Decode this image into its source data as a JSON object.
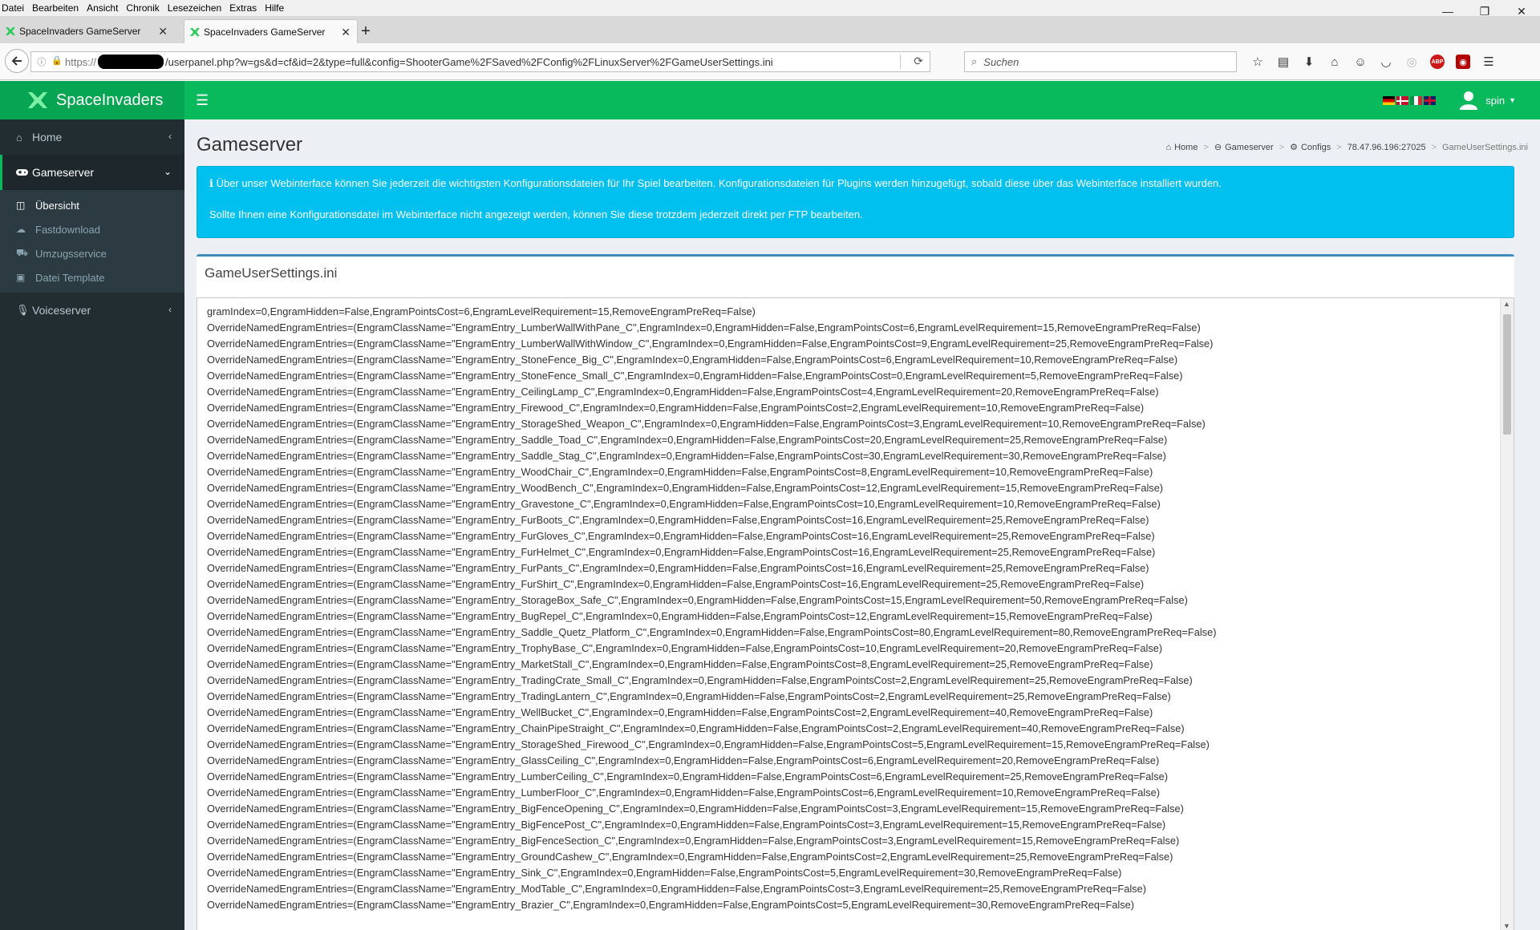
{
  "menubar": {
    "items": [
      "Datei",
      "Bearbeiten",
      "Ansicht",
      "Chronik",
      "Lesezeichen",
      "Extras",
      "Hilfe"
    ]
  },
  "window_controls": {
    "minimize": "—",
    "maximize": "❐",
    "close": "✕"
  },
  "tabs": [
    {
      "label": "SpaceInvaders GameServer"
    },
    {
      "label": "SpaceInvaders GameServer"
    }
  ],
  "tab_close": "✕",
  "newtab": "+",
  "navbar": {
    "url_proto": "https://",
    "url_rest": "/userpanel.php?w=gs&d=cf&id=2&type=full&config=ShooterGame%2FSaved%2FConfig%2FLinuxServer%2FGameUserSettings.ini",
    "search_placeholder": "Suchen"
  },
  "header": {
    "brand": "SpaceInvaders",
    "username": "spin",
    "accent": "#09ba5c",
    "accent_dark": "#06a553"
  },
  "sidebar": {
    "items": [
      {
        "label": "Home",
        "icon": "home-icon"
      },
      {
        "label": "Gameserver",
        "icon": "gamepad-icon"
      },
      {
        "label": "Voiceserver",
        "icon": "microphone-icon"
      }
    ],
    "sub_items": [
      {
        "label": "Übersicht",
        "icon": "columns-icon"
      },
      {
        "label": "Fastdownload",
        "icon": "cloud-download-icon"
      },
      {
        "label": "Umzugsservice",
        "icon": "truck-icon"
      },
      {
        "label": "Datei Template",
        "icon": "save-icon"
      }
    ]
  },
  "content": {
    "page_title": "Gameserver",
    "breadcrumb": [
      "Home",
      "Gameserver",
      "Configs",
      "78.47.96.196:27025",
      "GameUserSettings.ini"
    ],
    "alert_line1": "Über unser Webinterface können Sie jederzeit die wichtigsten Konfigurationsdateien für Ihr Spiel bearbeiten. Konfigurationsdateien für Plugins werden hinzugefügt, sobald diese über das Webinterface installiert wurden.",
    "alert_line2": "Sollte Ihnen eine Konfigurationsdatei im Webinterface nicht angezeigt werden, können Sie diese trotzdem jederzeit direkt per FTP bearbeiten.",
    "box_title": "GameUserSettings.ini"
  },
  "editor": {
    "lines": [
      "gramIndex=0,EngramHidden=False,EngramPointsCost=6,EngramLevelRequirement=15,RemoveEngramPreReq=False)",
      "OverrideNamedEngramEntries=(EngramClassName=\"EngramEntry_LumberWallWithPane_C\",EngramIndex=0,EngramHidden=False,EngramPointsCost=6,EngramLevelRequirement=15,RemoveEngramPreReq=False)",
      "OverrideNamedEngramEntries=(EngramClassName=\"EngramEntry_LumberWallWithWindow_C\",EngramIndex=0,EngramHidden=False,EngramPointsCost=9,EngramLevelRequirement=25,RemoveEngramPreReq=False)",
      "OverrideNamedEngramEntries=(EngramClassName=\"EngramEntry_StoneFence_Big_C\",EngramIndex=0,EngramHidden=False,EngramPointsCost=6,EngramLevelRequirement=10,RemoveEngramPreReq=False)",
      "OverrideNamedEngramEntries=(EngramClassName=\"EngramEntry_StoneFence_Small_C\",EngramIndex=0,EngramHidden=False,EngramPointsCost=0,EngramLevelRequirement=5,RemoveEngramPreReq=False)",
      "OverrideNamedEngramEntries=(EngramClassName=\"EngramEntry_CeilingLamp_C\",EngramIndex=0,EngramHidden=False,EngramPointsCost=4,EngramLevelRequirement=20,RemoveEngramPreReq=False)",
      "OverrideNamedEngramEntries=(EngramClassName=\"EngramEntry_Firewood_C\",EngramIndex=0,EngramHidden=False,EngramPointsCost=2,EngramLevelRequirement=10,RemoveEngramPreReq=False)",
      "OverrideNamedEngramEntries=(EngramClassName=\"EngramEntry_StorageShed_Weapon_C\",EngramIndex=0,EngramHidden=False,EngramPointsCost=3,EngramLevelRequirement=10,RemoveEngramPreReq=False)",
      "OverrideNamedEngramEntries=(EngramClassName=\"EngramEntry_Saddle_Toad_C\",EngramIndex=0,EngramHidden=False,EngramPointsCost=20,EngramLevelRequirement=25,RemoveEngramPreReq=False)",
      "OverrideNamedEngramEntries=(EngramClassName=\"EngramEntry_Saddle_Stag_C\",EngramIndex=0,EngramHidden=False,EngramPointsCost=30,EngramLevelRequirement=30,RemoveEngramPreReq=False)",
      "OverrideNamedEngramEntries=(EngramClassName=\"EngramEntry_WoodChair_C\",EngramIndex=0,EngramHidden=False,EngramPointsCost=8,EngramLevelRequirement=10,RemoveEngramPreReq=False)",
      "OverrideNamedEngramEntries=(EngramClassName=\"EngramEntry_WoodBench_C\",EngramIndex=0,EngramHidden=False,EngramPointsCost=12,EngramLevelRequirement=15,RemoveEngramPreReq=False)",
      "OverrideNamedEngramEntries=(EngramClassName=\"EngramEntry_Gravestone_C\",EngramIndex=0,EngramHidden=False,EngramPointsCost=10,EngramLevelRequirement=10,RemoveEngramPreReq=False)",
      "OverrideNamedEngramEntries=(EngramClassName=\"EngramEntry_FurBoots_C\",EngramIndex=0,EngramHidden=False,EngramPointsCost=16,EngramLevelRequirement=25,RemoveEngramPreReq=False)",
      "OverrideNamedEngramEntries=(EngramClassName=\"EngramEntry_FurGloves_C\",EngramIndex=0,EngramHidden=False,EngramPointsCost=16,EngramLevelRequirement=25,RemoveEngramPreReq=False)",
      "OverrideNamedEngramEntries=(EngramClassName=\"EngramEntry_FurHelmet_C\",EngramIndex=0,EngramHidden=False,EngramPointsCost=16,EngramLevelRequirement=25,RemoveEngramPreReq=False)",
      "OverrideNamedEngramEntries=(EngramClassName=\"EngramEntry_FurPants_C\",EngramIndex=0,EngramHidden=False,EngramPointsCost=16,EngramLevelRequirement=25,RemoveEngramPreReq=False)",
      "OverrideNamedEngramEntries=(EngramClassName=\"EngramEntry_FurShirt_C\",EngramIndex=0,EngramHidden=False,EngramPointsCost=16,EngramLevelRequirement=25,RemoveEngramPreReq=False)",
      "OverrideNamedEngramEntries=(EngramClassName=\"EngramEntry_StorageBox_Safe_C\",EngramIndex=0,EngramHidden=False,EngramPointsCost=15,EngramLevelRequirement=50,RemoveEngramPreReq=False)",
      "OverrideNamedEngramEntries=(EngramClassName=\"EngramEntry_BugRepel_C\",EngramIndex=0,EngramHidden=False,EngramPointsCost=12,EngramLevelRequirement=15,RemoveEngramPreReq=False)",
      "OverrideNamedEngramEntries=(EngramClassName=\"EngramEntry_Saddle_Quetz_Platform_C\",EngramIndex=0,EngramHidden=False,EngramPointsCost=80,EngramLevelRequirement=80,RemoveEngramPreReq=False)",
      "OverrideNamedEngramEntries=(EngramClassName=\"EngramEntry_TrophyBase_C\",EngramIndex=0,EngramHidden=False,EngramPointsCost=10,EngramLevelRequirement=20,RemoveEngramPreReq=False)",
      "OverrideNamedEngramEntries=(EngramClassName=\"EngramEntry_MarketStall_C\",EngramIndex=0,EngramHidden=False,EngramPointsCost=8,EngramLevelRequirement=25,RemoveEngramPreReq=False)",
      "OverrideNamedEngramEntries=(EngramClassName=\"EngramEntry_TradingCrate_Small_C\",EngramIndex=0,EngramHidden=False,EngramPointsCost=2,EngramLevelRequirement=25,RemoveEngramPreReq=False)",
      "OverrideNamedEngramEntries=(EngramClassName=\"EngramEntry_TradingLantern_C\",EngramIndex=0,EngramHidden=False,EngramPointsCost=2,EngramLevelRequirement=25,RemoveEngramPreReq=False)",
      "OverrideNamedEngramEntries=(EngramClassName=\"EngramEntry_WellBucket_C\",EngramIndex=0,EngramHidden=False,EngramPointsCost=2,EngramLevelRequirement=40,RemoveEngramPreReq=False)",
      "OverrideNamedEngramEntries=(EngramClassName=\"EngramEntry_ChainPipeStraight_C\",EngramIndex=0,EngramHidden=False,EngramPointsCost=2,EngramLevelRequirement=40,RemoveEngramPreReq=False)",
      "OverrideNamedEngramEntries=(EngramClassName=\"EngramEntry_StorageShed_Firewood_C\",EngramIndex=0,EngramHidden=False,EngramPointsCost=5,EngramLevelRequirement=15,RemoveEngramPreReq=False)",
      "OverrideNamedEngramEntries=(EngramClassName=\"EngramEntry_GlassCeiling_C\",EngramIndex=0,EngramHidden=False,EngramPointsCost=6,EngramLevelRequirement=20,RemoveEngramPreReq=False)",
      "OverrideNamedEngramEntries=(EngramClassName=\"EngramEntry_LumberCeiling_C\",EngramIndex=0,EngramHidden=False,EngramPointsCost=6,EngramLevelRequirement=25,RemoveEngramPreReq=False)",
      "OverrideNamedEngramEntries=(EngramClassName=\"EngramEntry_LumberFloor_C\",EngramIndex=0,EngramHidden=False,EngramPointsCost=6,EngramLevelRequirement=10,RemoveEngramPreReq=False)",
      "OverrideNamedEngramEntries=(EngramClassName=\"EngramEntry_BigFenceOpening_C\",EngramIndex=0,EngramHidden=False,EngramPointsCost=3,EngramLevelRequirement=15,RemoveEngramPreReq=False)",
      "OverrideNamedEngramEntries=(EngramClassName=\"EngramEntry_BigFencePost_C\",EngramIndex=0,EngramHidden=False,EngramPointsCost=3,EngramLevelRequirement=15,RemoveEngramPreReq=False)",
      "OverrideNamedEngramEntries=(EngramClassName=\"EngramEntry_BigFenceSection_C\",EngramIndex=0,EngramHidden=False,EngramPointsCost=3,EngramLevelRequirement=15,RemoveEngramPreReq=False)",
      "OverrideNamedEngramEntries=(EngramClassName=\"EngramEntry_GroundCashew_C\",EngramIndex=0,EngramHidden=False,EngramPointsCost=2,EngramLevelRequirement=25,RemoveEngramPreReq=False)",
      "OverrideNamedEngramEntries=(EngramClassName=\"EngramEntry_Sink_C\",EngramIndex=0,EngramHidden=False,EngramPointsCost=5,EngramLevelRequirement=30,RemoveEngramPreReq=False)",
      "OverrideNamedEngramEntries=(EngramClassName=\"EngramEntry_ModTable_C\",EngramIndex=0,EngramHidden=False,EngramPointsCost=3,EngramLevelRequirement=25,RemoveEngramPreReq=False)",
      "OverrideNamedEngramEntries=(EngramClassName=\"EngramEntry_Brazier_C\",EngramIndex=0,EngramHidden=False,EngramPointsCost=5,EngramLevelRequirement=30,RemoveEngramPreReq=False)"
    ]
  }
}
